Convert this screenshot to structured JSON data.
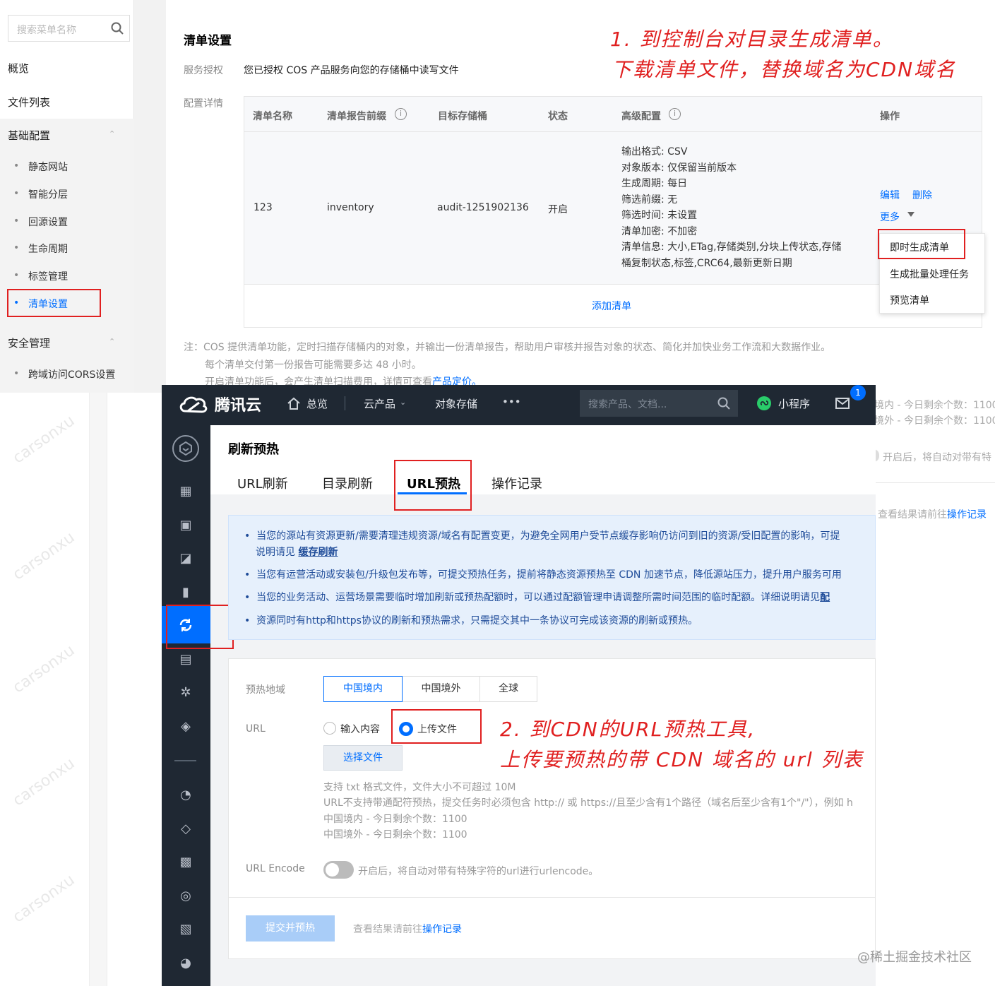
{
  "cos": {
    "search_placeholder": "搜索菜单名称",
    "menu": {
      "overview": "概览",
      "files": "文件列表",
      "basic": "基础配置",
      "static": "静态网站",
      "tiering": "智能分层",
      "origin": "回源设置",
      "lifecycle": "生命周期",
      "tags": "标签管理",
      "inventory": "清单设置",
      "security": "安全管理",
      "cors": "跨域访问CORS设置"
    },
    "title": "清单设置",
    "auth_label": "服务授权",
    "auth_text": "您已授权 COS 产品服务向您的存储桶中读写文件",
    "config_label": "配置详情",
    "headers": {
      "name": "清单名称",
      "prefix": "清单报告前缀",
      "bucket": "目标存储桶",
      "status": "状态",
      "advanced": "高级配置",
      "ops": "操作"
    },
    "row": {
      "name": "123",
      "prefix": "inventory",
      "bucket": "audit-1251902136",
      "status": "开启",
      "cfg_format": "输出格式:  CSV",
      "cfg_version": "对象版本:  仅保留当前版本",
      "cfg_cycle": "生成周期:  每日",
      "cfg_prefix": "筛选前缀:  无",
      "cfg_time": "筛选时间:  未设置",
      "cfg_enc": "清单加密:  不加密",
      "cfg_info1": "清单信息:  大小,ETag,存储类别,分块上传状态,存储",
      "cfg_info2": "桶复制状态,标签,CRC64,最新更新日期",
      "edit": "编辑",
      "delete": "删除",
      "more": "更多"
    },
    "dropdown": {
      "instant": "即时生成清单",
      "batch": "生成批量处理任务",
      "preview": "预览清单"
    },
    "add": "添加清单",
    "note1": "注：COS 提供清单功能，定时扫描存储桶内的对象，并输出一份清单报告，帮助用户审核并报告对象的状态、简化并加快业务工作流和大数据作业。",
    "note2": "每个清单交付第一份报告可能需要多达 48 小时。",
    "note3": "开启清单功能后，会产生清单扫描费用，详情可查看",
    "note3_link": "产品定价。"
  },
  "rstrip": {
    "l1": "境内 - 今日剩余个数：1100",
    "l2": "境外 - 今日剩余个数：1100",
    "l3": "开启后，将自动对带有特",
    "l4": "查看结果请前往",
    "l4_link": "操作记录"
  },
  "cdn": {
    "brand": "腾讯云",
    "nav_overview": "总览",
    "nav_products": "云产品",
    "nav_cos": "对象存储",
    "nav_more": "•••",
    "search_placeholder": "搜索产品、文档...",
    "mini": "小程序",
    "badge": "1",
    "page_title": "刷新预热",
    "tabs": [
      "URL刷新",
      "目录刷新",
      "URL预热",
      "操作记录"
    ],
    "info1a": "当您的源站有资源更新/需要清理违规资源/域名有配置变更，为避免全网用户受节点缓存影响仍访问到旧的资源/受旧配置的影响，可提",
    "info1b": "说明请见",
    "info1_link": "缓存刷新",
    "info2": "当您有运营活动或安装包/升级包发布等，可提交预热任务，提前将静态资源预热至 CDN 加速节点，降低源站压力，提升用户服务可用",
    "info3": "当您的业务活动、运营场景需要临时增加刷新或预热配额时，可以通过配额管理申请调整所需时间范围的临时配额。详细说明请见",
    "info3_link": "配",
    "info4": "资源同时有http和https协议的刷新和预热需求，只需提交其中一条协议可完成该资源的刷新或预热。",
    "region_label": "预热地域",
    "regions": [
      "中国境内",
      "中国境外",
      "全球"
    ],
    "url_label": "URL",
    "opt_input": "输入内容",
    "opt_upload": "上传文件",
    "choose_file": "选择文件",
    "help1": "支持 txt 格式文件，文件大小不可超过 10M",
    "help2": "URL不支持带通配符预热，提交任务时必须包含 http:// 或 https://且至少含有1个路径（域名后至少含有1个\"/\"），例如 h",
    "help3": "中国境内 - 今日剩余个数：1100",
    "help4": "中国境外 - 今日剩余个数：1100",
    "encode_label": "URL Encode",
    "encode_text": "开启后，将自动对带有特殊字符的url进行urlencode。",
    "submit": "提交并预热",
    "result_text": "查看结果请前往",
    "result_link": "操作记录"
  },
  "annotations": {
    "a1_line1": "1. 到控制台对目录生成清单。",
    "a1_line2": "下载清单文件，替换域名为CDN域名",
    "a2_line1": "2. 到CDN的URL预热工具,",
    "a2_line2": "上传要预热的带 CDN 域名的 url 列表"
  },
  "watermark": "carsonxu",
  "footer_watermark": "@稀土掘金技术社区"
}
